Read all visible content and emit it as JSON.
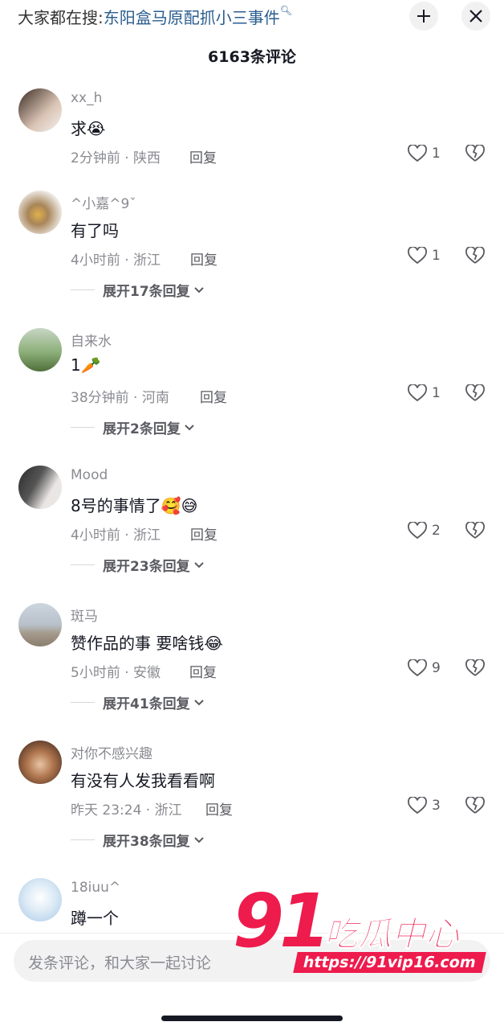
{
  "header": {
    "search_prefix": "大家都在搜:",
    "search_keyword": "东阳盒马原配抓小三事件",
    "comment_count_title": "6163条评论"
  },
  "comments": [
    {
      "user": "xx_h",
      "text": "求😭",
      "time": "2分钟前",
      "region": "陕西",
      "reply": "回复",
      "likes": "1",
      "expand": ""
    },
    {
      "user": "^小嘉^9ˇ",
      "text": "有了吗",
      "time": "4小时前",
      "region": "浙江",
      "reply": "回复",
      "likes": "1",
      "expand": "展开17条回复"
    },
    {
      "user": "自来水",
      "text": "1🥕",
      "time": "38分钟前",
      "region": "河南",
      "reply": "回复",
      "likes": "1",
      "expand": "展开2条回复"
    },
    {
      "user": "Mood",
      "text": "8号的事情了🥰😅",
      "time": "4小时前",
      "region": "浙江",
      "reply": "回复",
      "likes": "2",
      "expand": "展开23条回复"
    },
    {
      "user": "斑马",
      "text": "赞作品的事 要啥钱😂",
      "time": "5小时前",
      "region": "安徽",
      "reply": "回复",
      "likes": "9",
      "expand": "展开41条回复"
    },
    {
      "user": "对你不感兴趣",
      "text": "有没有人发我看看啊",
      "time": "昨天 23:24",
      "region": "浙江",
      "reply": "回复",
      "likes": "3",
      "expand": "展开38条回复"
    },
    {
      "user": "18iuu^",
      "text": "蹲一个",
      "time": "",
      "region": "",
      "reply": "",
      "likes": "",
      "expand": ""
    }
  ],
  "composer": {
    "placeholder": "发条评论，和大家一起讨论"
  },
  "watermark": {
    "number": "91",
    "name": "吃瓜中心",
    "url": "https://91vip16.com"
  },
  "colors": {
    "accent": "#ee1b4d",
    "link": "#2a5d8f",
    "muted": "#8a8b91",
    "text": "#161823"
  }
}
